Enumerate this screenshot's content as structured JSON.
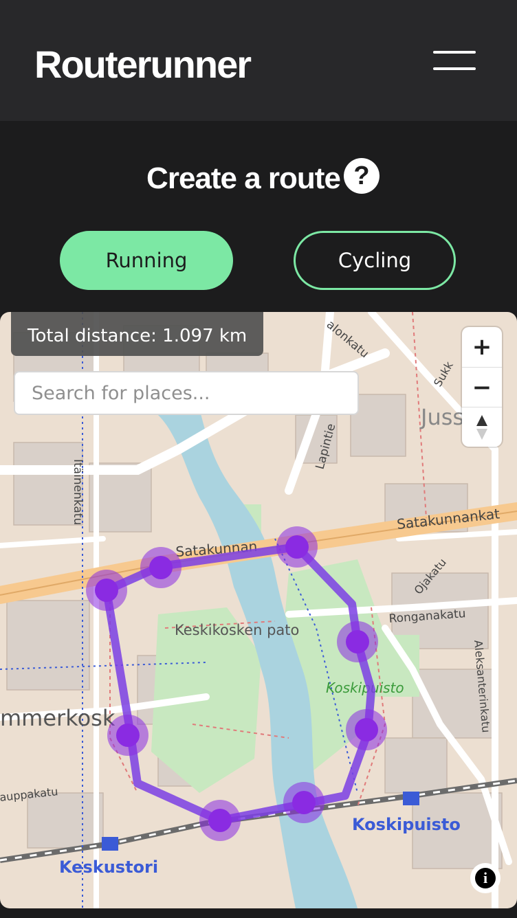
{
  "app": {
    "title": "Routerunner",
    "menu_icon": "hamburger-menu-icon"
  },
  "page": {
    "title": "Create a route",
    "help_icon_text": "?"
  },
  "modes": {
    "running_label": "Running",
    "cycling_label": "Cycling",
    "selected": "Running"
  },
  "map": {
    "total_distance": "Total distance: 1.097 km",
    "search_placeholder": "Search for places...",
    "zoom_in_label": "+",
    "zoom_out_label": "−",
    "attribution_icon_text": "i",
    "route_color": "#7b3fe4",
    "waypoint_color": "#8a2be2",
    "labels": {
      "satakunnankatu_east": "Satakunnankat",
      "satakunnankatu_west": "Satakunnan",
      "keskikosken_pato": "Keskikosken pato",
      "koskipuisto_park": "Koskipuisto",
      "koskipuisto_stop": "Koskipuisto",
      "keskustori": "Keskustori",
      "hammerkoski": "mmerkosk",
      "itainenkatu": "Itäinenkatu",
      "lapintie": "Lapintie",
      "kalevankatu": "alonkatu",
      "ronganakatu": "Ronganakatu",
      "aleksanterinkatu": "Aleksanterinkatu",
      "ojakatu": "Ojakatu",
      "hauppakatu": "auppakatu",
      "jussi": "Juss",
      "sukk": "Sukk"
    }
  },
  "colors": {
    "accent": "#7ce8a4",
    "header_bg": "#28282a",
    "page_bg": "#1c1c1d"
  }
}
